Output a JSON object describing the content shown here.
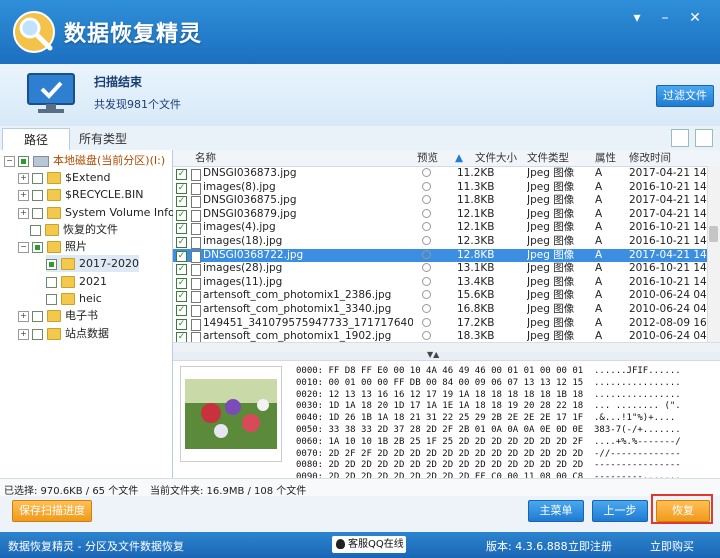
{
  "app": {
    "title": "数据恢复精灵",
    "window_controls": [
      "▾",
      "–",
      "✕"
    ]
  },
  "scan": {
    "status": "扫描结束",
    "found": "共发现981个文件",
    "filter_label": "过滤文件"
  },
  "tabs": [
    {
      "label": "路径",
      "active": true
    },
    {
      "label": "所有类型",
      "active": false
    }
  ],
  "tree": {
    "root": "本地磁盘(当前分区)(I:)",
    "items": [
      {
        "label": "$Extend"
      },
      {
        "label": "$RECYCLE.BIN"
      },
      {
        "label": "System Volume Inform"
      },
      {
        "label": "恢复的文件"
      },
      {
        "label": "照片"
      },
      {
        "label": "2017-2020"
      },
      {
        "label": "2021"
      },
      {
        "label": "heic"
      },
      {
        "label": "电子书"
      },
      {
        "label": "站点数据"
      }
    ]
  },
  "columns": [
    "名称",
    "预览",
    "文件大小",
    "文件类型",
    "属性",
    "修改时间"
  ],
  "files": [
    {
      "name": "DNSGI036873.jpg",
      "size": "11.2KB",
      "type": "Jpeg 图像",
      "attr": "A",
      "mtime": "2017-04-21 14:1"
    },
    {
      "name": "images(8).jpg",
      "size": "11.3KB",
      "type": "Jpeg 图像",
      "attr": "A",
      "mtime": "2016-10-21 14:1"
    },
    {
      "name": "DNSGI036875.jpg",
      "size": "11.8KB",
      "type": "Jpeg 图像",
      "attr": "A",
      "mtime": "2017-04-21 14:1"
    },
    {
      "name": "DNSGI036879.jpg",
      "size": "12.1KB",
      "type": "Jpeg 图像",
      "attr": "A",
      "mtime": "2017-04-21 14:1"
    },
    {
      "name": "images(4).jpg",
      "size": "12.1KB",
      "type": "Jpeg 图像",
      "attr": "A",
      "mtime": "2016-10-21 14:1"
    },
    {
      "name": "images(18).jpg",
      "size": "12.3KB",
      "type": "Jpeg 图像",
      "attr": "A",
      "mtime": "2016-10-21 14:1"
    },
    {
      "name": "DNSGI0368722.jpg",
      "size": "12.8KB",
      "type": "Jpeg 图像",
      "attr": "A",
      "mtime": "2017-04-21 14:1",
      "selected": true
    },
    {
      "name": "images(28).jpg",
      "size": "13.1KB",
      "type": "Jpeg 图像",
      "attr": "A",
      "mtime": "2016-10-21 14:1"
    },
    {
      "name": "images(11).jpg",
      "size": "13.4KB",
      "type": "Jpeg 图像",
      "attr": "A",
      "mtime": "2016-10-21 14:1"
    },
    {
      "name": "artensoft_com_photomix1_2386.jpg",
      "size": "15.6KB",
      "type": "Jpeg 图像",
      "attr": "A",
      "mtime": "2010-06-24 04:4"
    },
    {
      "name": "artensoft_com_photomix1_3340.jpg",
      "size": "16.8KB",
      "type": "Jpeg 图像",
      "attr": "A",
      "mtime": "2010-06-24 04:4"
    },
    {
      "name": "149451_341079575947733_1717176403...",
      "size": "17.2KB",
      "type": "Jpeg 图像",
      "attr": "A",
      "mtime": "2012-08-09 16:1"
    },
    {
      "name": "artensoft_com_photomix1_1902.jpg",
      "size": "18.3KB",
      "type": "Jpeg 图像",
      "attr": "A",
      "mtime": "2010-06-24 04:4"
    }
  ],
  "hex_lines": [
    "0000: FF D8 FF E0 00 10 4A 46 49 46 00 01 01 00 00 01  ......JFIF......",
    "0010: 00 01 00 00 FF DB 00 84 00 09 06 07 13 13 12 15  ................",
    "0020: 12 13 13 16 16 12 17 19 1A 18 18 18 18 18 1B 18  ................",
    "0030: 1D 1A 18 20 1D 17 1A 1E 1A 18 18 19 20 28 22 18  ... ........ (\".",
    "0040: 1D 26 1B 1A 18 21 31 22 25 29 2B 2E 2E 2E 17 1F  .&...!1\"%)+....",
    "0050: 33 38 33 2D 37 28 2D 2F 2B 01 0A 0A 0A 0E 0D 0E  383-7(-/+.......",
    "0060: 1A 10 10 1B 2B 25 1F 25 2D 2D 2D 2D 2D 2D 2D 2F  ....+%.%-------/",
    "0070: 2D 2F 2F 2D 2D 2D 2D 2D 2D 2D 2D 2D 2D 2D 2D 2D  -//-------------",
    "0080: 2D 2D 2D 2D 2D 2D 2D 2D 2D 2D 2D 2D 2D 2D 2D 2D  ----------------",
    "0090: 2D 2D 2D 2D 2D 2D 2D 2D 2D FF C0 00 11 08 00 C8  ---------.......",
    "00A0: 01 2C 03 01 22 00 02 11 01 03 11 01 FF C4 00 1B  .,..\"..........."
  ],
  "statusbar": {
    "selected": "已选择: 970.6KB / 65 个文件",
    "current_folder": "当前文件夹: 16.9MB / 108 个文件"
  },
  "buttons": {
    "save_progress": "保存扫描进度",
    "main_menu": "主菜单",
    "previous": "上一步",
    "recover": "恢复"
  },
  "footer": {
    "left": "数据恢复精灵 - 分区及文件数据恢复",
    "qq": "客服QQ在线",
    "version": "版本: 4.3.6.888",
    "register": "立即注册",
    "buy": "立即购买"
  }
}
